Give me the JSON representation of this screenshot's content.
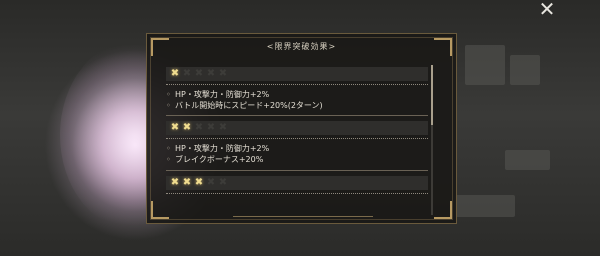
{
  "panel": {
    "title": "<限界突破効果>"
  },
  "sections": [
    {
      "stars_on": 1,
      "stars_total": 5,
      "lines": [
        "HP・攻撃力・防御力+2%",
        "バトル開始時にスピード+20%(2ターン)"
      ]
    },
    {
      "stars_on": 2,
      "stars_total": 5,
      "lines": [
        "HP・攻撃力・防御力+2%",
        "ブレイクボーナス+20%"
      ]
    },
    {
      "stars_on": 3,
      "stars_total": 5,
      "lines": []
    }
  ],
  "icons": {
    "close": "close-icon",
    "star": "star-icon"
  },
  "colors": {
    "star_on": "#efdc8f",
    "star_off": "#3d3c39",
    "panel_bg": "#1a1917",
    "text": "#e4dfd4",
    "border": "#b79a63"
  }
}
